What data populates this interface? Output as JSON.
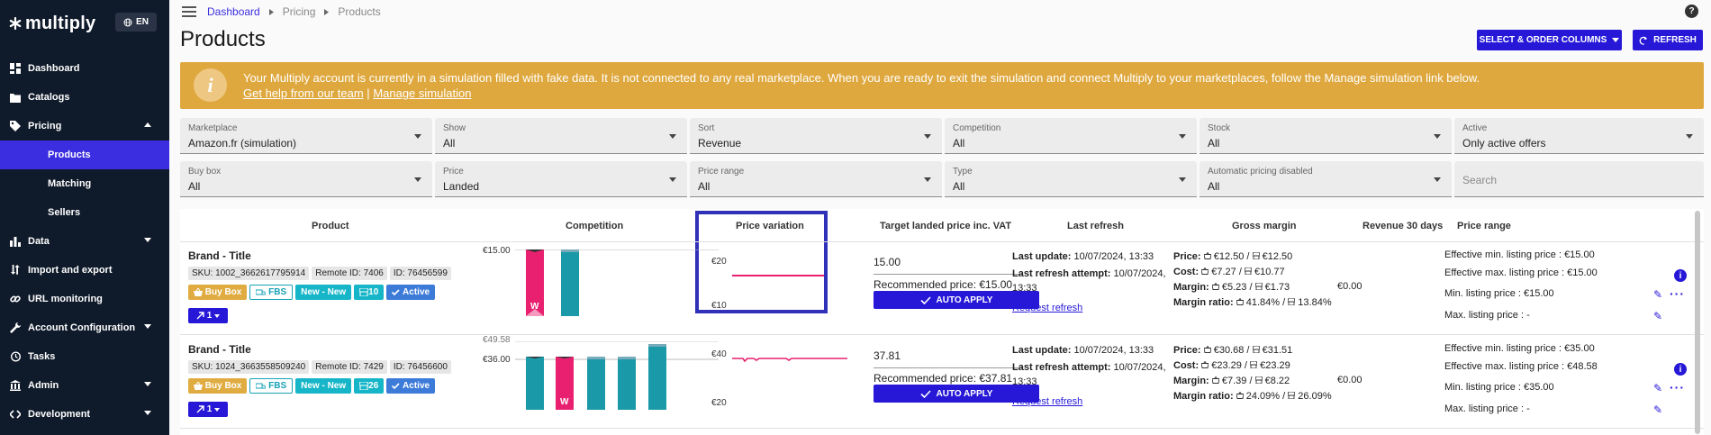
{
  "sidebar": {
    "brand": "multiply",
    "lang": "EN",
    "items": [
      {
        "label": "Dashboard",
        "icon": "dashboard-icon"
      },
      {
        "label": "Catalogs",
        "icon": "folder-icon"
      },
      {
        "label": "Pricing",
        "icon": "tag-icon"
      },
      {
        "label": "Products"
      },
      {
        "label": "Matching"
      },
      {
        "label": "Sellers"
      },
      {
        "label": "Data",
        "icon": "chart-icon"
      },
      {
        "label": "Import and export",
        "icon": "swap-icon"
      },
      {
        "label": "URL monitoring",
        "icon": "link-icon"
      },
      {
        "label": "Account Configuration",
        "icon": "wrench-icon"
      },
      {
        "label": "Tasks",
        "icon": "history-icon"
      },
      {
        "label": "Admin",
        "icon": "bank-icon"
      },
      {
        "label": "Development",
        "icon": "code-icon"
      }
    ]
  },
  "breadcrumb": [
    "Dashboard",
    "Pricing",
    "Products"
  ],
  "page_title": "Products",
  "buttons": {
    "select_columns": "SELECT & ORDER COLUMNS",
    "refresh": "REFRESH"
  },
  "banner": {
    "text": "Your Multiply account is currently in a simulation filled with fake data. It is not connected to any real marketplace. When you are ready to exit the simulation and connect Multiply to your marketplaces, follow the Manage simulation link below.",
    "link_help": "Get help from our team",
    "separator": "|",
    "link_manage": "Manage simulation"
  },
  "filters": [
    {
      "label": "Marketplace",
      "value": "Amazon.fr (simulation)"
    },
    {
      "label": "Show",
      "value": "All"
    },
    {
      "label": "Sort",
      "value": "Revenue"
    },
    {
      "label": "Competition",
      "value": "All"
    },
    {
      "label": "Stock",
      "value": "All"
    },
    {
      "label": "Active",
      "value": "Only active offers"
    },
    {
      "label": "Buy box",
      "value": "All"
    },
    {
      "label": "Price",
      "value": "Landed"
    },
    {
      "label": "Price range",
      "value": "All"
    },
    {
      "label": "Type",
      "value": "All"
    },
    {
      "label": "Automatic pricing disabled",
      "value": "All"
    }
  ],
  "search": {
    "placeholder": "Search"
  },
  "columns": [
    "Product",
    "Competition",
    "Price variation",
    "Target landed price inc. VAT",
    "Last refresh",
    "Gross margin",
    "Revenue 30 days",
    "Price range"
  ],
  "rows": [
    {
      "title": "Brand - Title",
      "sku": "SKU: 1002_3662617795914",
      "remote_id": "Remote ID: 7406",
      "id": "ID: 76456599",
      "badges": {
        "buybox": "Buy Box",
        "fbs": "FBS",
        "new": "New - New",
        "count": "10",
        "active": "Active"
      },
      "action": "1",
      "comp_labels": [
        "€15.00"
      ],
      "pv_labels": [
        "€20",
        "€10"
      ],
      "target_value": "15.00",
      "recommended": "Recommended price: €15.00",
      "auto_apply": "AUTO APPLY",
      "last_update_label": "Last update:",
      "last_update": "10/07/2024, 13:33",
      "last_attempt_label": "Last refresh attempt:",
      "last_attempt": "10/07/2024,",
      "last_attempt_time": "13:33",
      "request_refresh": "Request refresh",
      "price_label": "Price:",
      "price": "€12.50 / ",
      "price2": "€12.50",
      "cost_label": "Cost:",
      "cost": "€7.27 / ",
      "cost2": "€10.77",
      "margin_label": "Margin:",
      "margin": "€5.23 / ",
      "margin2": "€1.73",
      "ratio_label": "Margin ratio:",
      "ratio": "41.84% / ",
      "ratio2": "13.84%",
      "revenue": "€0.00",
      "eff_min": "Effective min. listing price :  €15.00",
      "eff_max": "Effective max. listing price :  €15.00",
      "min_price": "Min. listing price :  €15.00",
      "max_price": "Max. listing price :  -"
    },
    {
      "title": "Brand - Title",
      "sku": "SKU: 1024_3663558509240",
      "remote_id": "Remote ID: 7429",
      "id": "ID: 76456600",
      "badges": {
        "buybox": "Buy Box",
        "fbs": "FBS",
        "new": "New - New",
        "count": "26",
        "active": "Active"
      },
      "action": "1",
      "comp_labels": [
        "€49.58",
        "€36.00"
      ],
      "pv_labels": [
        "€40",
        "€20"
      ],
      "target_value": "37.81",
      "recommended": "Recommended price: €37.81",
      "auto_apply": "AUTO APPLY",
      "last_update_label": "Last update:",
      "last_update": "10/07/2024, 13:33",
      "last_attempt_label": "Last refresh attempt:",
      "last_attempt": "10/07/2024,",
      "last_attempt_time": "13:33",
      "request_refresh": "Request refresh",
      "price_label": "Price:",
      "price": "€30.68 / ",
      "price2": "€31.51",
      "cost_label": "Cost:",
      "cost": "€23.29 / ",
      "cost2": "€23.29",
      "margin_label": "Margin:",
      "margin": "€7.39 / ",
      "margin2": "€8.22",
      "ratio_label": "Margin ratio:",
      "ratio": "24.09% / ",
      "ratio2": "26.09%",
      "revenue": "€0.00",
      "eff_min": "Effective min. listing price :  €35.00",
      "eff_max": "Effective max. listing price :  €48.58",
      "min_price": "Min. listing price :  €35.00",
      "max_price": "Max. listing price :  -"
    }
  ],
  "colors": {
    "accent": "#2718d8",
    "sidebar": "#0f1a2a",
    "banner": "#dfa83e",
    "pink": "#e8206f",
    "teal": "#1a9aa8"
  }
}
